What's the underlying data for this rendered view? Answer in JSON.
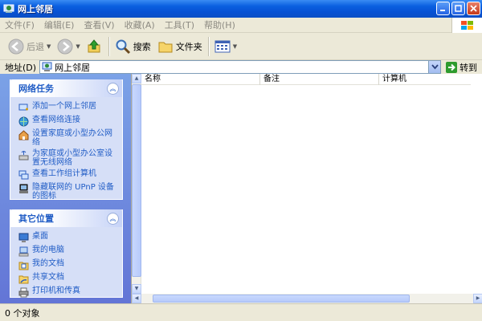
{
  "window": {
    "title": "网上邻居"
  },
  "menu": [
    "文件(F)",
    "编辑(E)",
    "查看(V)",
    "收藏(A)",
    "工具(T)",
    "帮助(H)"
  ],
  "toolbar": {
    "back": "后退",
    "search": "搜索",
    "folders": "文件夹"
  },
  "address": {
    "label": "地址(D)",
    "value": "网上邻居",
    "go": "转到"
  },
  "network_tasks": {
    "title": "网络任务",
    "items": [
      {
        "label": "添加一个网上邻居",
        "icon": "add-network-place-icon"
      },
      {
        "label": "查看网络连接",
        "icon": "network-connections-icon"
      },
      {
        "label": "设置家庭或小型办公网络",
        "icon": "home-network-setup-icon"
      },
      {
        "label": "为家庭或小型办公室设置无线网络",
        "icon": "wireless-network-icon"
      },
      {
        "label": "查看工作组计算机",
        "icon": "workgroup-computers-icon"
      },
      {
        "label": "隐藏联网的 UPnP 设备的图标",
        "icon": "upnp-device-icon"
      }
    ]
  },
  "other_places": {
    "title": "其它位置",
    "items": [
      {
        "label": "桌面",
        "icon": "desktop-icon"
      },
      {
        "label": "我的电脑",
        "icon": "my-computer-icon"
      },
      {
        "label": "我的文档",
        "icon": "my-documents-icon"
      },
      {
        "label": "共享文档",
        "icon": "shared-documents-icon"
      },
      {
        "label": "打印机和传真",
        "icon": "printers-faxes-icon"
      }
    ]
  },
  "columns": [
    "名称",
    "备注",
    "计算机"
  ],
  "status": {
    "text": "0 个对象"
  },
  "colors": {
    "titlebar": "#0a5fe0",
    "link": "#215dc6",
    "pane": "#6f8fe0",
    "chrome": "#ece9d8"
  }
}
